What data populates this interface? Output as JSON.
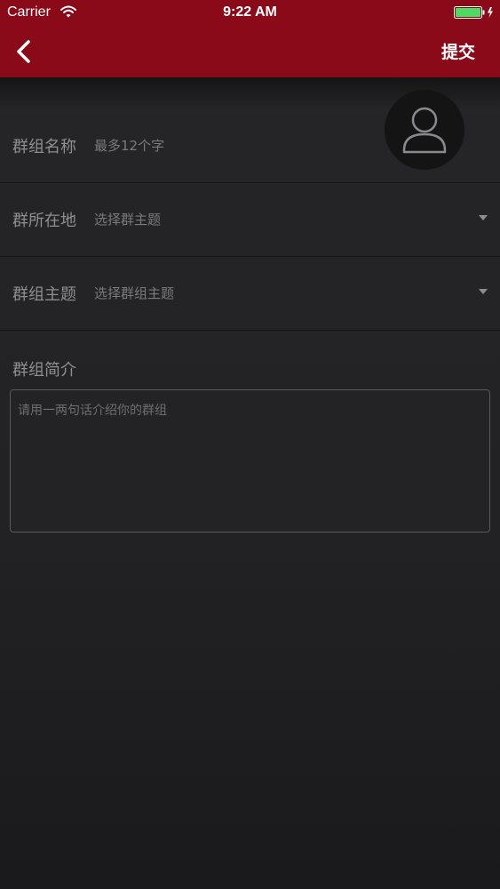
{
  "status_bar": {
    "carrier": "Carrier",
    "time": "9:22 AM"
  },
  "nav": {
    "back_icon": "chevron-left-icon",
    "submit_label": "提交",
    "background_color": "#8b0a1a"
  },
  "avatar": {
    "icon": "user-icon"
  },
  "form": {
    "group_name": {
      "label": "群组名称",
      "placeholder": "最多12个字"
    },
    "location": {
      "label": "群所在地",
      "value": "选择群主题"
    },
    "theme": {
      "label": "群组主题",
      "value": "选择群组主题"
    },
    "intro": {
      "label": "群组简介",
      "placeholder": "请用一两句话介绍你的群组"
    }
  }
}
